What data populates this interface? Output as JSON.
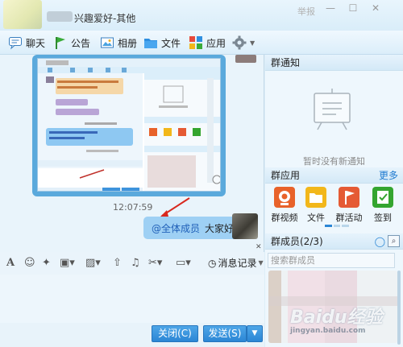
{
  "titlebar": {
    "title": "兴趣爱好-其他",
    "report": "举报"
  },
  "toolbar": {
    "chat": "聊天",
    "announcement": "公告",
    "album": "相册",
    "files": "文件",
    "apps": "应用"
  },
  "chat": {
    "time": "12:07:59",
    "mention": "@全体成员",
    "message": "大家好"
  },
  "input": {
    "history": "消息记录"
  },
  "buttons": {
    "close": "关闭(C)",
    "send": "发送(S)"
  },
  "group_notice": {
    "header": "群通知",
    "empty": "暂时没有新通知"
  },
  "group_apps": {
    "header": "群应用",
    "more": "更多",
    "items": [
      "群视频",
      "文件",
      "群活动",
      "签到"
    ],
    "colors": [
      "#e8622a",
      "#f2b71a",
      "#e55a34",
      "#34a52f"
    ]
  },
  "group_members": {
    "header": "群成员(2/3)",
    "search_placeholder": "搜索群成员"
  },
  "watermark": {
    "text": "Baidu经验",
    "sub": "jingyan.baidu.com"
  }
}
